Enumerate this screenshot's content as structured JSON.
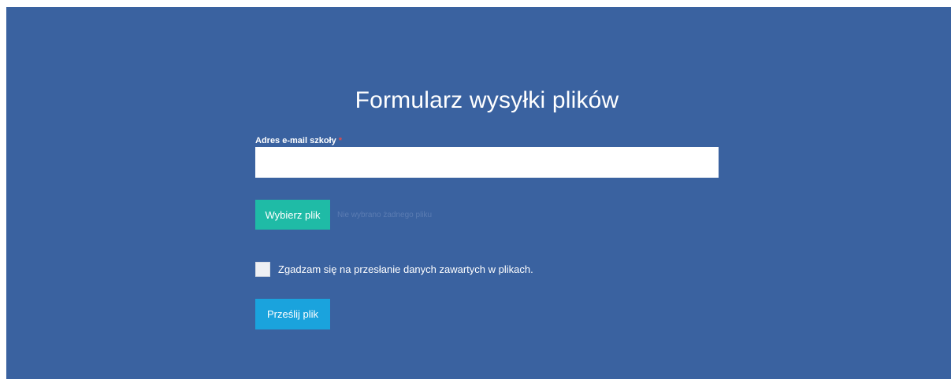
{
  "form": {
    "title": "Formularz wysyłki plików",
    "email": {
      "label": "Adres e-mail szkoły",
      "required_marker": "*",
      "value": "",
      "placeholder": ""
    },
    "file": {
      "button_label": "Wybierz plik",
      "status": "Nie wybrano żadnego pliku"
    },
    "consent": {
      "label": "Zgadzam się na przesłanie danych zawartych w plikach.",
      "checked": false
    },
    "submit_label": "Prześlij plik"
  },
  "colors": {
    "background": "#3a62a0",
    "file_button": "#1fbba6",
    "submit_button": "#1aa3dd",
    "required": "#e24c4c"
  }
}
